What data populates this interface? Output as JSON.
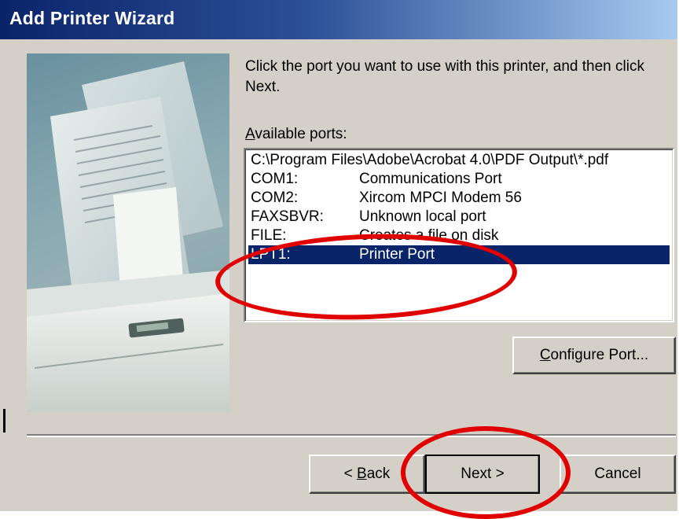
{
  "window": {
    "title": "Add Printer Wizard"
  },
  "instructions": "Click the port you want to use with this printer, and then click Next.",
  "ports_label": {
    "mnemonic": "A",
    "rest": "vailable ports:"
  },
  "ports": [
    {
      "port": "C:\\Program Files\\Adobe\\Acrobat 4.0\\PDF Output\\*.pdf",
      "description": "",
      "selected": false
    },
    {
      "port": "COM1:",
      "description": "Communications Port",
      "selected": false
    },
    {
      "port": "COM2:",
      "description": "Xircom MPCI Modem 56",
      "selected": false
    },
    {
      "port": "FAXSBVR:",
      "description": "Unknown local port",
      "selected": false
    },
    {
      "port": "FILE:",
      "description": "Creates a file on disk",
      "selected": false
    },
    {
      "port": "LPT1:",
      "description": "Printer Port",
      "selected": true
    }
  ],
  "buttons": {
    "configure": {
      "mnemonic": "C",
      "rest": "onfigure Port..."
    },
    "back": {
      "prefix": "< ",
      "mnemonic": "B",
      "rest": "ack"
    },
    "next": "Next >",
    "cancel": "Cancel"
  },
  "colors": {
    "title_bar_start": "#0a246a",
    "title_bar_end": "#a6caf0",
    "selection": "#0a246a",
    "dialog_face": "#d4d0c8",
    "annotation": "#e00000"
  },
  "annotations": [
    "red-circle-lpt1",
    "red-circle-next-button"
  ]
}
